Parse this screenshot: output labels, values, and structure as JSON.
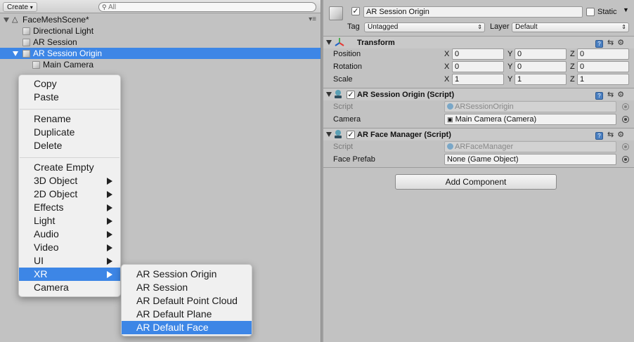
{
  "hierarchy": {
    "create_label": "Create",
    "create_caret": "▾",
    "search_placeholder": "All",
    "scene_name": "FaceMeshScene*",
    "items": [
      {
        "label": "Directional Light"
      },
      {
        "label": "AR Session"
      },
      {
        "label": "AR Session Origin"
      },
      {
        "label": "Main Camera"
      }
    ]
  },
  "context_menu": {
    "items": [
      "Copy",
      "Paste",
      "Rename",
      "Duplicate",
      "Delete",
      "Create Empty",
      "3D Object",
      "2D Object",
      "Effects",
      "Light",
      "Audio",
      "Video",
      "UI",
      "XR",
      "Camera"
    ],
    "highlighted": "XR"
  },
  "xr_submenu": {
    "items": [
      "AR Session Origin",
      "AR Session",
      "AR Default Point Cloud",
      "AR Default Plane",
      "AR Default Face"
    ],
    "highlighted": "AR Default Face"
  },
  "inspector": {
    "object_name": "AR Session Origin",
    "static_label": "Static",
    "tag_label": "Tag",
    "tag_value": "Untagged",
    "layer_label": "Layer",
    "layer_value": "Default",
    "transform": {
      "title": "Transform",
      "position_label": "Position",
      "rotation_label": "Rotation",
      "scale_label": "Scale",
      "axis_x": "X",
      "axis_y": "Y",
      "axis_z": "Z",
      "position": {
        "x": "0",
        "y": "0",
        "z": "0"
      },
      "rotation": {
        "x": "0",
        "y": "0",
        "z": "0"
      },
      "scale": {
        "x": "1",
        "y": "1",
        "z": "1"
      }
    },
    "session_origin": {
      "title": "AR Session Origin (Script)",
      "script_label": "Script",
      "script_value": "ARSessionOrigin",
      "camera_label": "Camera",
      "camera_value": "Main Camera (Camera)"
    },
    "face_manager": {
      "title": "AR Face Manager (Script)",
      "script_label": "Script",
      "script_value": "ARFaceManager",
      "prefab_label": "Face Prefab",
      "prefab_value": "None (Game Object)"
    },
    "add_component_label": "Add Component"
  },
  "colors": {
    "selection": "#3d86e6",
    "panel_bg": "#c2c2c2",
    "menu_bg": "#f0f0f0"
  }
}
